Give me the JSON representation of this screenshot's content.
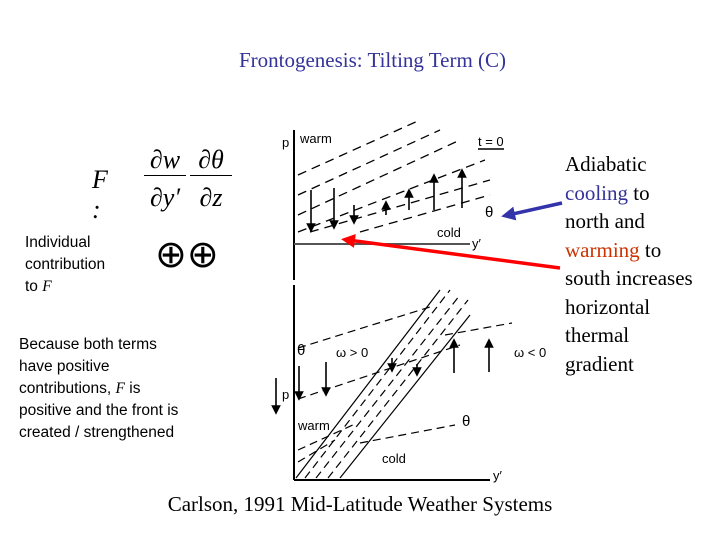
{
  "title": "Frontogenesis:  Tilting Term (C)",
  "equation": {
    "lhs": "F :",
    "num1": "∂w",
    "den1": "∂y′",
    "num2": "∂θ",
    "den2": "∂z"
  },
  "individual": {
    "line1": "Individual",
    "line2": "contribution",
    "line3": "to ",
    "var": "F"
  },
  "signs": "⊕⊕",
  "because": {
    "l1": "Because both terms",
    "l2": "have positive",
    "l3a": "contributions, ",
    "l3var": "F",
    "l3b": " is",
    "l4": "positive and the front is",
    "l5": "created / strengthened"
  },
  "explanation": {
    "w1": "Adiabatic",
    "cool": "cooling",
    "w2": " to",
    "w3": "north and",
    "warm": "warming",
    "w4": " to",
    "w5": "south increases",
    "w6": "horizontal",
    "w7": "thermal",
    "w8": "gradient"
  },
  "diagram": {
    "top": {
      "p": "p",
      "warm": "warm",
      "cold": "cold",
      "t": "t = 0",
      "theta": "θ",
      "y": "y′"
    },
    "bottom": {
      "p": "p",
      "warm": "warm",
      "cold": "cold",
      "theta1": "θ",
      "theta2": "θ",
      "omega_pos": "ω > 0",
      "omega_neg": "ω < 0",
      "y": "y′"
    }
  },
  "citation": "Carlson, 1991 Mid-Latitude Weather Systems",
  "colors": {
    "title": "#333399",
    "cooling": "#333399",
    "warming": "#cc3300",
    "arrow_red": "#ff0000",
    "arrow_blue": "#3333aa"
  }
}
